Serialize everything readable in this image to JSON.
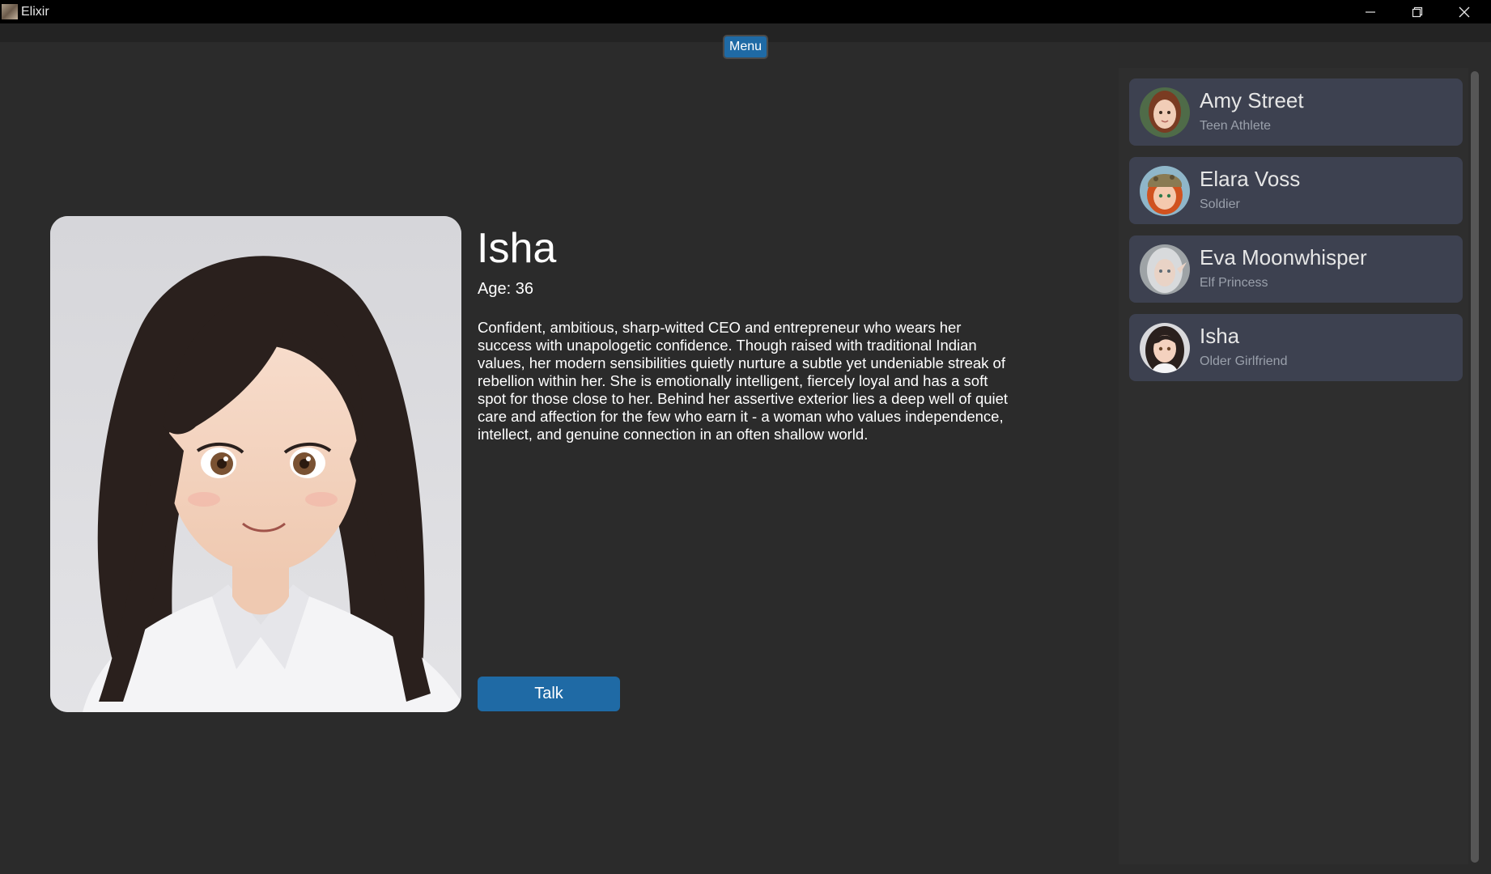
{
  "window": {
    "title": "Elixir",
    "icons": {
      "app": "app-icon",
      "minimize": "minimize-icon",
      "maximize": "restore-icon",
      "close": "close-icon"
    }
  },
  "toolbar": {
    "menu_label": "Menu"
  },
  "profile": {
    "name": "Isha",
    "age_text": "Age: 36",
    "bio": "Confident, ambitious, sharp-witted CEO and entrepreneur who wears her success with unapologetic confidence. Though raised with traditional Indian values, her modern sensibilities quietly nurture a subtle yet undeniable streak of rebellion within her. She is emotionally intelligent, fiercely loyal and has a soft spot for those close to her. Behind her assertive exterior lies a deep well of quiet care and affection for the few who earn it - a woman who values independence, intellect, and genuine connection in an often shallow world.",
    "talk_label": "Talk"
  },
  "sidebar": {
    "characters": [
      {
        "name": "Amy Street",
        "role": "Teen Athlete"
      },
      {
        "name": "Elara Voss",
        "role": "Soldier"
      },
      {
        "name": "Eva Moonwhisper",
        "role": "Elf Princess"
      },
      {
        "name": "Isha",
        "role": "Older Girlfriend"
      }
    ]
  },
  "colors": {
    "background": "#2b2b2b",
    "titlebar": "#000000",
    "accent": "#1f6aa5",
    "card": "#3d4150",
    "sidebar": "#2e2e2e",
    "scrollbar": "#565656"
  }
}
